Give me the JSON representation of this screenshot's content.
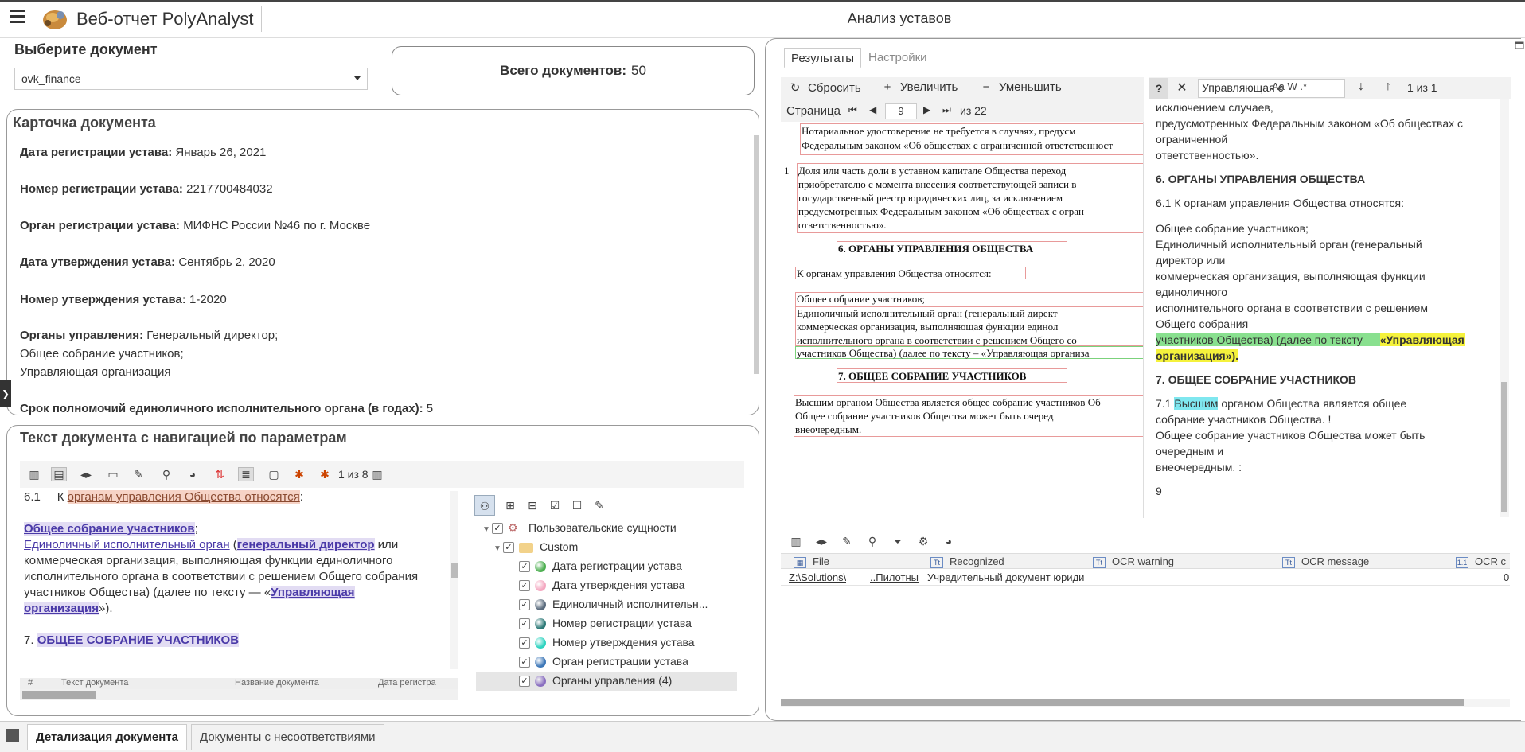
{
  "header": {
    "app_title": "Веб-отчет PolyAnalyst",
    "page_title": "Анализ уставов"
  },
  "doc_select": {
    "label": "Выберите документ",
    "value": "ovk_finance"
  },
  "total": {
    "label": "Всего документов:",
    "value": "50"
  },
  "card": {
    "title": "Карточка документа",
    "fields": [
      {
        "label": "Дата регистрации устава:",
        "value": "Январь 26, 2021"
      },
      {
        "label": "Номер регистрации устава:",
        "value": "2217700484032"
      },
      {
        "label": "Орган регистрации устава:",
        "value": "МИФНС России №46 по г. Москве"
      },
      {
        "label": "Дата утверждения устава:",
        "value": "Сентябрь 2, 2020"
      },
      {
        "label": "Номер утверждения устава:",
        "value": "1-2020"
      },
      {
        "label": "Органы управления:",
        "value": "Генеральный директор;",
        "extra": [
          "Общее собрание участников;",
          "Управляющая организация"
        ]
      },
      {
        "label": "Срок полномочий единоличного исполнительного органа (в годах):",
        "value": "5"
      }
    ]
  },
  "text_panel": {
    "title": "Текст документа с навигацией по параметрам",
    "counter": "1 из 8",
    "lines": {
      "l1_num": "6.1",
      "l1_pre": "К ",
      "l1_hl": "органам управления Общества относятся",
      "l1_post": ":",
      "l2_hl": "Общее собрание участников",
      "l2_post": ";",
      "l3_a": "Единоличный исполнительный орган",
      "l3_b": " (",
      "l3_c": "генеральный директор",
      "l3_d": " или",
      "l4": "коммерческая организация, выполняющая функции единоличного",
      "l5": "исполнительного органа в соответствии с решением Общего собрания",
      "l6_pre": "участников Общества) (далее по тексту — «",
      "l6_hl": "Управляющая",
      "l7_hl": "организация",
      "l7_post": "»).",
      "l8_num": "7.",
      "l8_hl": "ОБЩЕЕ СОБРАНИЕ УЧАСТНИКОВ"
    },
    "bottom_table_headers": [
      "#",
      "Текст документа",
      "Название документа",
      "Дата регистра"
    ]
  },
  "entities": {
    "root": "Пользовательские сущности",
    "folder": "Custom",
    "items": [
      {
        "label": "Дата регистрации устава",
        "color": "#4caf50"
      },
      {
        "label": "Дата утверждения устава",
        "color": "#f4a7c0"
      },
      {
        "label": "Единоличный исполнительн...",
        "color": "#5a6b7d"
      },
      {
        "label": "Номер регистрации устава",
        "color": "#2e7a78"
      },
      {
        "label": "Номер утверждения устава",
        "color": "#2fd3c0"
      },
      {
        "label": "Орган регистрации устава",
        "color": "#3e78b8"
      },
      {
        "label": "Органы управления (4)",
        "color": "#8a6fc0"
      }
    ]
  },
  "right": {
    "tabs": [
      "Результаты",
      "Настройки"
    ],
    "pdf_toolbar": {
      "reset": "Сбросить",
      "zoom_in": "Увеличить",
      "zoom_out": "Уменьшить",
      "page_label": "Страница",
      "page_value": "9",
      "of_pages": "из 22"
    },
    "find": {
      "query": "Управляющая с",
      "opts": "Aa  W  .*",
      "count": "1 из 1"
    },
    "pdf_lines": [
      "Нотариальное удостоверение не требуется в случаях, предусм",
      "Федеральным законом «Об обществах с ограниченной ответственност",
      "Доля или часть доли в уставном капитале Общества переход",
      "приобретателю с момента внесения соответствующей записи в",
      "государственный реестр юридических лиц, за исключением",
      "предусмотренных Федеральным законом «Об обществах с огран",
      "ответственностью».",
      "6.        ОРГАНЫ УПРАВЛЕНИЯ ОБЩЕСТВА",
      "К органам управления Общества относятся:",
      "Общее собрание участников;",
      "Единоличный исполнительный орган (генеральный директ",
      "коммерческая организация, выполняющая функции единол",
      "исполнительного органа в соответствии с решением Общего со",
      "участников Общества) (далее по тексту – «Управляющая организа",
      "7.        ОБЩЕЕ СОБРАНИЕ УЧАСТНИКОВ",
      "Высшим органом Общества является общее собрание участников Об",
      "Общее собрание участников Общества может быть очеред",
      "внеочередным."
    ],
    "ext_text": {
      "l0": "исключением случаев,",
      "l1": "предусмотренных Федеральным законом «Об обществах с",
      "l2": "ограниченной",
      "l3": "ответственностью».",
      "h6": "6. ОРГАНЫ УПРАВЛЕНИЯ ОБЩЕСТВА",
      "l61": "6.1      К органам управления Общества относятся:",
      "l7": "Общее собрание участников;",
      "l8": "Единоличный исполнительный орган (генеральный",
      "l9": "директор или",
      "l10": "коммерческая организация, выполняющая функции",
      "l11": "единоличного",
      "l12": "исполнительного органа в соответствии с решением",
      "l13": "Общего собрания",
      "l14_green": "участников Общества) (далее по тексту — ",
      "l14_yellow": "«Управляющая",
      "l15_yellow": "организация»).",
      "h7_num": "7. ",
      "h7": "ОБЩЕЕ СОБРАНИЕ УЧАСТНИКОВ",
      "l71_num": "7.1      ",
      "l71_cyan": "Высшим",
      "l71_post": " органом Общества является общее",
      "l72": "собрание участников Общества.      !",
      "l73": "Общее собрание участников Общества может быть",
      "l74": "очередным и",
      "l75": "внеочередным.      :",
      "pg": "9"
    },
    "grid": {
      "headers": [
        "File",
        "Recognized",
        "OCR warning",
        "OCR message",
        "OCR c"
      ],
      "row": {
        "file_a": "Z:\\Solutions\\",
        "file_b": "..Пилотны",
        "recognized": "Учредительный документ юриди",
        "ocr_last": "0"
      }
    }
  },
  "bottom_tabs": [
    "Детализация документа",
    "Документы с несоответствиями"
  ]
}
